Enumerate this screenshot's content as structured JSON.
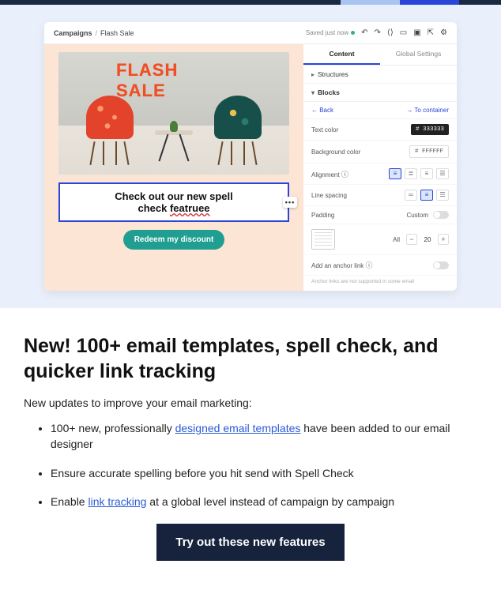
{
  "preview": {
    "breadcrumb": {
      "root": "Campaigns",
      "current": "Flash Sale"
    },
    "status": "Saved just now",
    "hero_title": "FLASH SALE",
    "spellcheck_line1": "Check out our new spell",
    "spellcheck_line2_pre": "check ",
    "spellcheck_typo": "featruee",
    "redeem_label": "Redeem my discount",
    "tabs": {
      "content": "Content",
      "global": "Global Settings"
    },
    "acc_structures": "Structures",
    "acc_blocks": "Blocks",
    "back": "← Back",
    "to_container": "→ To container",
    "rows": {
      "text_color": {
        "label": "Text color",
        "value": "# 333333"
      },
      "bg_color": {
        "label": "Background color",
        "value": "# FFFFFF"
      },
      "alignment": "Alignment",
      "line_spacing": "Line spacing",
      "padding": {
        "label": "Padding",
        "custom": "Custom"
      },
      "all": "All",
      "all_value": "20",
      "anchor": "Add an anchor link",
      "anchor_note": "Anchor links are not supported in some email"
    }
  },
  "article": {
    "heading": "New! 100+ email templates, spell check, and quicker link tracking",
    "intro": "New updates to improve your email marketing:",
    "b1_pre": "100+ new, professionally ",
    "b1_link": "designed email templates",
    "b1_post": " have been added to our email designer",
    "b2": "Ensure accurate spelling before you hit send with Spell Check",
    "b3_pre": "Enable ",
    "b3_link": "link tracking",
    "b3_post": " at a global level instead of campaign by campaign",
    "cta": "Try out these new features"
  }
}
